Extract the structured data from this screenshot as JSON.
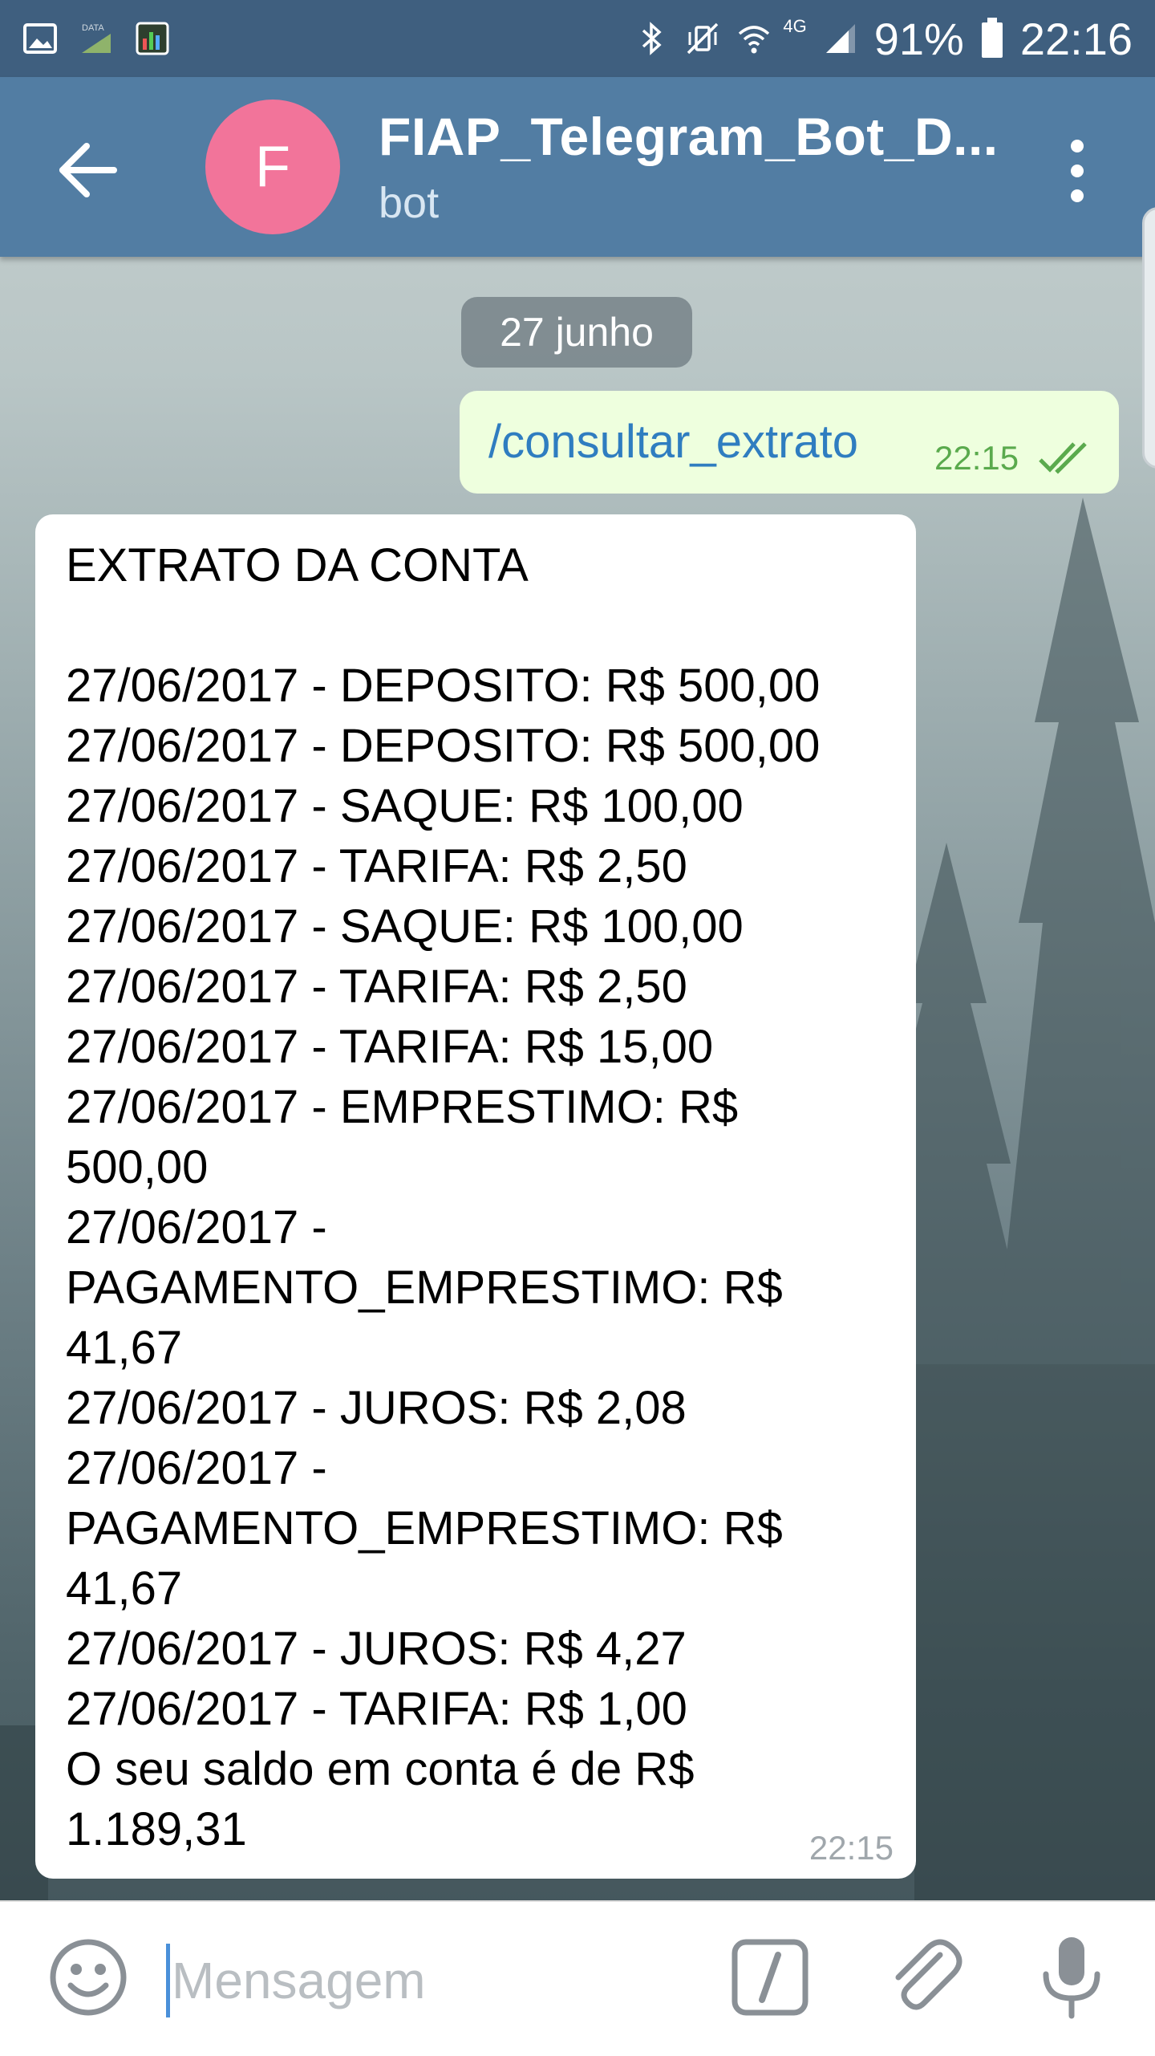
{
  "status_bar": {
    "battery": "91%",
    "time": "22:16",
    "network": "4G",
    "left_icons": [
      "image-icon",
      "data-icon",
      "chart-app-icon"
    ],
    "right_icons": [
      "bluetooth-icon",
      "vibrate-icon",
      "wifi-icon",
      "signal-icon",
      "battery-icon"
    ]
  },
  "header": {
    "avatar_letter": "F",
    "title": "FIAP_Telegram_Bot_D...",
    "subtitle": "bot",
    "colors": {
      "bar": "#527da3",
      "avatar": "#f2749a"
    }
  },
  "chat": {
    "date_chip": "27 junho",
    "outgoing": {
      "text": "/consultar_extrato",
      "time": "22:15",
      "status": "read"
    },
    "incoming": {
      "text": "EXTRATO DA CONTA\n\n27/06/2017 - DEPOSITO: R$ 500,00\n27/06/2017 - DEPOSITO: R$ 500,00\n27/06/2017 - SAQUE: R$ 100,00\n27/06/2017 - TARIFA: R$ 2,50\n27/06/2017 - SAQUE: R$ 100,00\n27/06/2017 - TARIFA: R$ 2,50\n27/06/2017 - TARIFA: R$ 15,00\n27/06/2017 - EMPRESTIMO: R$\n500,00\n27/06/2017 -\nPAGAMENTO_EMPRESTIMO: R$\n41,67\n27/06/2017 - JUROS: R$ 2,08\n27/06/2017 -\nPAGAMENTO_EMPRESTIMO: R$\n41,67\n27/06/2017 - JUROS: R$ 4,27\n27/06/2017 - TARIFA: R$ 1,00\nO seu saldo em conta é de R$\n1.189,31",
      "time": "22:15"
    }
  },
  "composer": {
    "placeholder": "Mensagem",
    "icons": [
      "emoji-icon",
      "bot-command-icon",
      "attach-icon",
      "microphone-icon"
    ]
  }
}
